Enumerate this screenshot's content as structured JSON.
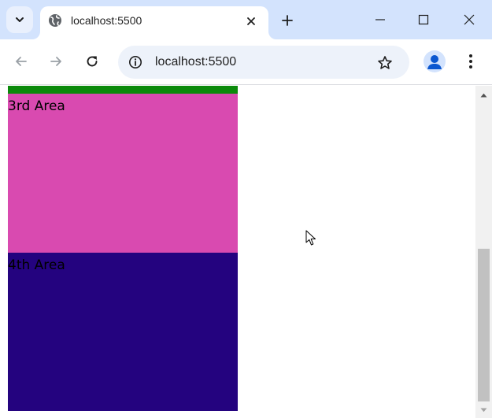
{
  "browser": {
    "tab": {
      "title": "localhost:5500",
      "favicon": "globe-icon"
    },
    "url": "localhost:5500",
    "icons": {
      "tab_search": "chevron-down-icon",
      "tab_close": "close-icon",
      "new_tab": "plus-icon",
      "minimize": "minimize-icon",
      "maximize": "maximize-icon",
      "window_close": "close-icon",
      "back": "arrow-left-icon",
      "forward": "arrow-right-icon",
      "reload": "reload-icon",
      "site_info": "info-icon",
      "bookmark": "star-icon",
      "profile": "person-icon",
      "menu": "kebab-menu-icon"
    },
    "colors": {
      "tabstrip": "#d3e3fd",
      "omnibox": "#edf2fa"
    }
  },
  "page": {
    "areas": [
      {
        "label": "",
        "color": "#0b8a0b"
      },
      {
        "label": "3rd Area",
        "color": "#d94ab0"
      },
      {
        "label": "4th Area",
        "color": "#24037f"
      }
    ]
  },
  "scrollbar": {
    "scroll_fraction": 1.0
  }
}
